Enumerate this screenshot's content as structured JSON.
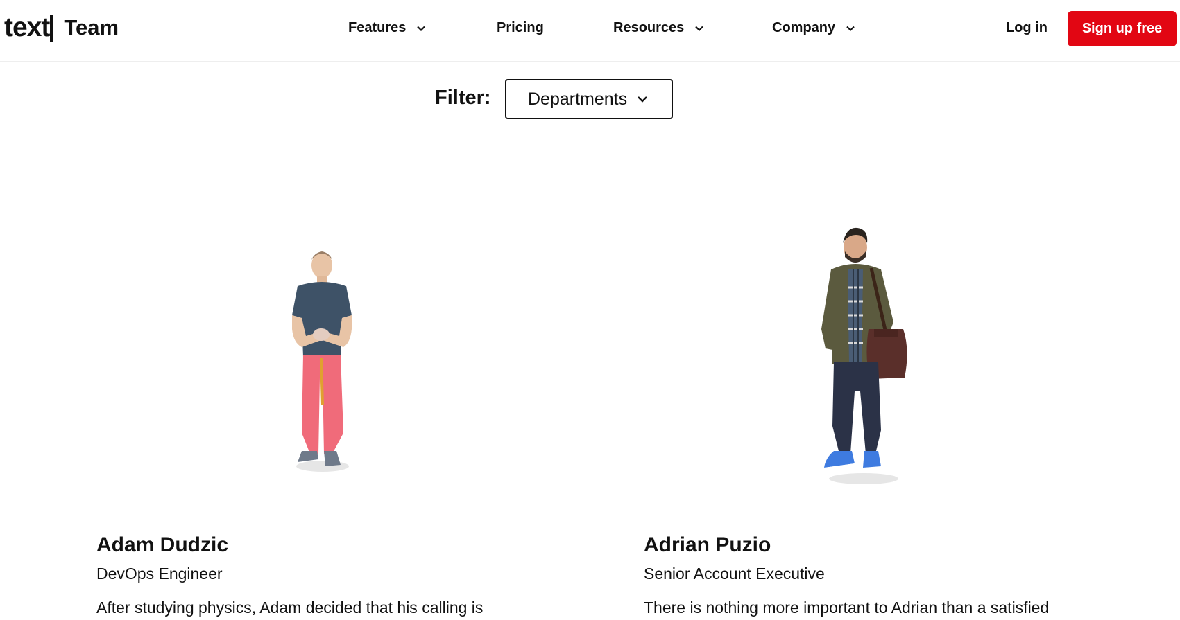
{
  "header": {
    "logo_text": "text",
    "logo_section": "Team",
    "nav": [
      {
        "label": "Features",
        "has_dropdown": true
      },
      {
        "label": "Pricing",
        "has_dropdown": false
      },
      {
        "label": "Resources",
        "has_dropdown": true
      },
      {
        "label": "Company",
        "has_dropdown": true
      }
    ],
    "login_label": "Log in",
    "signup_label": "Sign up free",
    "accent_color": "#e20613"
  },
  "filter": {
    "label": "Filter:",
    "selected": "Departments"
  },
  "team": [
    {
      "name": "Adam Dudzic",
      "role": "DevOps Engineer",
      "bio": "After studying physics, Adam decided that his calling is",
      "photo": "person-standing-blue-tshirt-red-pants"
    },
    {
      "name": "Adrian Puzio",
      "role": "Senior Account Executive",
      "bio": "There is nothing more important to Adrian than a satisfied",
      "photo": "person-standing-green-jacket-bag"
    }
  ]
}
